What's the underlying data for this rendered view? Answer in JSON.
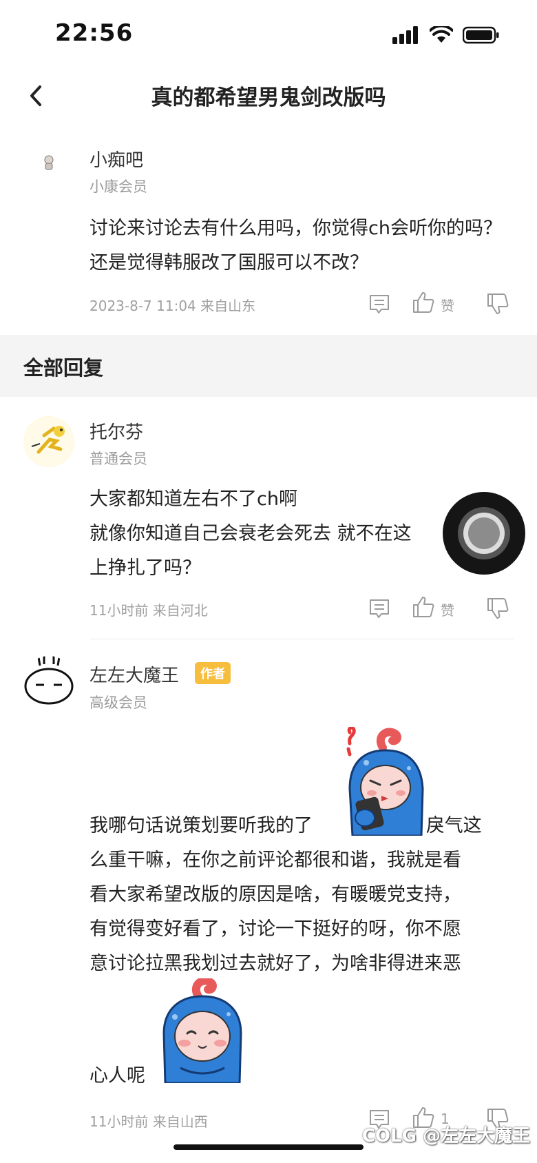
{
  "status_bar": {
    "time": "22:56"
  },
  "nav": {
    "title": "真的都希望男鬼剑改版吗"
  },
  "main_post": {
    "username": "小痴吧",
    "level": "小康会员",
    "content": "讨论来讨论去有什么用吗，你觉得ch会听你的吗？还是觉得韩服改了国服可以不改？",
    "meta": "2023-8-7 11:04  来自山东",
    "like_label": "赞"
  },
  "section": {
    "title": "全部回复"
  },
  "replies": [
    {
      "username": "托尔芬",
      "level": "普通会员",
      "content_lines": [
        "大家都知道左右不了ch啊",
        "就像你知道自己会衰老会死去 就不在这",
        "上挣扎了吗？"
      ],
      "meta": "11小时前 来自河北",
      "like_label": "赞"
    },
    {
      "username": "左左大魔王",
      "badge": "作者",
      "level": "高级会员",
      "content_part1": "我哪句话说策划要听我的了",
      "content_part2": " 戾气这",
      "content_lines": [
        "么重干嘛，在你之前评论都很和谐，我就是看",
        "看大家希望改版的原因是啥，有暖暖党支持，",
        "有觉得变好看了，讨论一下挺好的呀，你不愿",
        "意讨论拉黑我划过去就好了，为啥非得进来恶"
      ],
      "content_last": "心人呢",
      "meta": "11小时前 来自山西",
      "like_count": "1"
    }
  ],
  "watermark": "COLG @左左大魔王",
  "colors": {
    "badge": "#f7bd3d",
    "section_bg": "#f4f4f4",
    "sticker_blue": "#2f7fd6"
  }
}
